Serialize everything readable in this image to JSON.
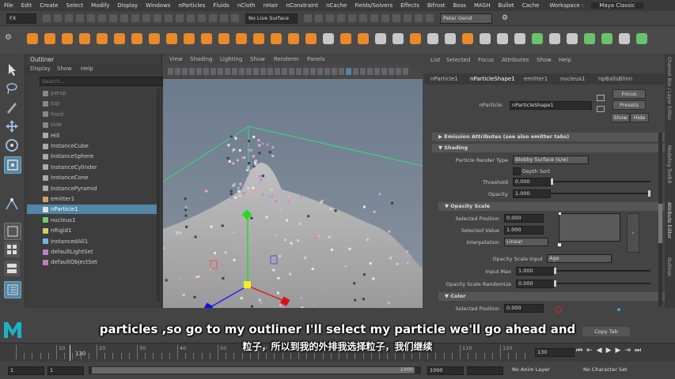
{
  "menubar": {
    "items": [
      "File",
      "Edit",
      "Create",
      "Select",
      "Modify",
      "Display",
      "Windows",
      "nParticles",
      "Fluids",
      "nCloth",
      "nHair",
      "nConstraint",
      "nCache",
      "Fields/Solvers",
      "Effects",
      "Bifrost",
      "Boss",
      "MASH",
      "Bullet",
      "Cache"
    ],
    "workspace_label": "Workspace :",
    "workspace_value": "Maya Classic"
  },
  "statusline": {
    "mode": "FX",
    "live_surface": "No Live Surface",
    "user": "Peter Gend"
  },
  "outliner": {
    "title": "Outliner",
    "menu": [
      "Display",
      "Show",
      "Help"
    ],
    "search_placeholder": "Search...",
    "items": [
      {
        "label": "persp",
        "icon": "camera-icon",
        "dim": true
      },
      {
        "label": "top",
        "icon": "camera-icon",
        "dim": true
      },
      {
        "label": "front",
        "icon": "camera-icon",
        "dim": true
      },
      {
        "label": "side",
        "icon": "camera-icon",
        "dim": true
      },
      {
        "label": "Hill",
        "icon": "mesh-icon",
        "dim": false
      },
      {
        "label": "InstanceCube",
        "icon": "mesh-icon",
        "dim": false
      },
      {
        "label": "InstanceSphere",
        "icon": "mesh-icon",
        "dim": false
      },
      {
        "label": "InstanceCylinder",
        "icon": "mesh-icon",
        "dim": false
      },
      {
        "label": "InstanceCone",
        "icon": "mesh-icon",
        "dim": false
      },
      {
        "label": "InstancePyramid",
        "icon": "mesh-icon",
        "dim": false
      },
      {
        "label": "emitter1",
        "icon": "emitter-icon",
        "dim": false
      },
      {
        "label": "nParticle1",
        "icon": "particle-icon",
        "dim": false,
        "selected": true
      },
      {
        "label": "nucleus1",
        "icon": "nucleus-icon",
        "dim": false
      },
      {
        "label": "nRigid1",
        "icon": "rigid-icon",
        "dim": false
      },
      {
        "label": "instancedAll1",
        "icon": "instancer-icon",
        "dim": false
      },
      {
        "label": "defaultLightSet",
        "icon": "set-icon",
        "dim": false
      },
      {
        "label": "defaultObjectSet",
        "icon": "set-icon",
        "dim": false
      }
    ]
  },
  "viewport": {
    "menu": [
      "View",
      "Shading",
      "Lighting",
      "Show",
      "Renderer",
      "Panels"
    ]
  },
  "attr": {
    "menu": [
      "List",
      "Selected",
      "Focus",
      "Attributes",
      "Show",
      "Help"
    ],
    "tabs": [
      "nParticle1",
      "nParticleShape1",
      "emitter1",
      "nucleus1",
      "npBallsBlinn"
    ],
    "node_label": "nParticle:",
    "node_value": "nParticleShape1",
    "focus": "Focus",
    "presets": "Presets",
    "show": "Show",
    "hide": "Hide",
    "sections": {
      "emission": "Emission Attributes (see also emitter tabs)",
      "shading": "Shading",
      "opacity_scale": "Opacity Scale",
      "color": "Color"
    },
    "particle_render_type_label": "Particle Render Type",
    "particle_render_type": "Blobby Surface (s/w)",
    "depth_sort": "Depth Sort",
    "threshold_label": "Threshold",
    "threshold": "0.000",
    "opacity_label": "Opacity",
    "opacity": "1.000",
    "selected_position_label": "Selected Position",
    "selected_position": "0.000",
    "selected_value_label": "Selected Value",
    "selected_value": "1.000",
    "interpolation_label": "Interpolation",
    "interpolation": "Linear",
    "opacity_scale_input_label": "Opacity Scale Input",
    "opacity_scale_input": "Age",
    "input_max_label": "Input Max",
    "input_max": "1.000",
    "opacity_scale_randomize_label": "Opacity Scale Randomize",
    "opacity_scale_randomize": "0.000",
    "color_selected_position_label": "Selected Position",
    "color_selected_position": "0.000",
    "copy_tab": "Copy Tab"
  },
  "sidetabs": {
    "a": "Channel Box / Layer Editor",
    "b": "Modeling Toolkit",
    "c": "Attribute Editor",
    "d": "Outliner"
  },
  "timeline": {
    "ticks": [
      "10",
      "20",
      "30",
      "40",
      "50",
      "60",
      "70",
      "80",
      "90",
      "100",
      "110",
      "120"
    ],
    "current_frame": "130",
    "frame_field": "130"
  },
  "rangebar": {
    "start": "1",
    "start2": "1",
    "end": "1000",
    "end2": "1000",
    "anim_layer": "No Anim Layer",
    "character_set": "No Character Set"
  },
  "subtitles": {
    "en": "particles ,so go to my outliner I'll select my particle we'll go ahead and",
    "zh": "粒子，所以到我的外排我选择粒子，我们继续"
  }
}
